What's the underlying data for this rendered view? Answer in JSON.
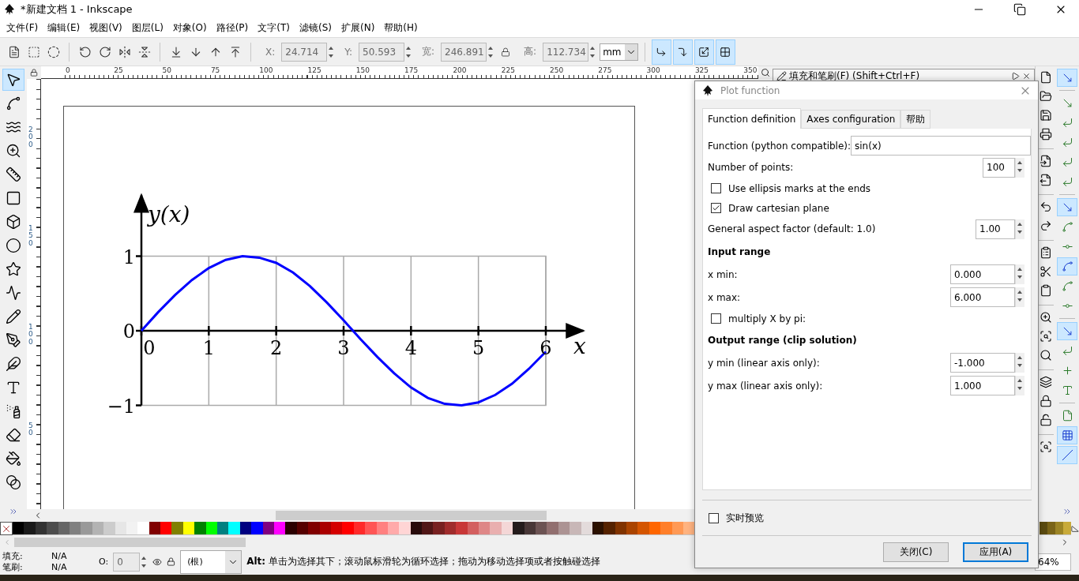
{
  "window": {
    "title": "*新建文档 1 - Inkscape"
  },
  "menu": [
    "文件(F)",
    "编辑(E)",
    "视图(V)",
    "图层(L)",
    "对象(O)",
    "路径(P)",
    "文字(T)",
    "滤镜(S)",
    "扩展(N)",
    "帮助(H)"
  ],
  "toolbar": {
    "fields": [
      {
        "label": "X:",
        "value": "24.714",
        "disabled": true
      },
      {
        "label": "Y:",
        "value": "50.593",
        "disabled": true
      },
      {
        "label": "宽:",
        "value": "246.891",
        "disabled": true
      },
      {
        "label": "高:",
        "value": "112.734",
        "disabled": true
      }
    ],
    "unit": "mm",
    "toggles": [
      {
        "on": true
      },
      {
        "on": true
      },
      {
        "on": true
      },
      {
        "on": true
      }
    ]
  },
  "tools": [
    {
      "selected": true
    },
    {
      "selected": false
    },
    {
      "selected": false
    },
    {
      "selected": false
    },
    {
      "selected": false
    },
    {
      "selected": false
    },
    {
      "selected": false
    },
    {
      "selected": false
    },
    {
      "selected": false
    },
    {
      "selected": false
    },
    {
      "selected": false
    },
    {
      "selected": false
    },
    {
      "selected": false
    },
    {
      "selected": false
    },
    {
      "selected": false
    },
    {
      "selected": false
    },
    {
      "selected": false
    },
    {
      "selected": false
    }
  ],
  "ruler": {
    "horizontal": [
      "0",
      "25",
      "50",
      "75",
      "100",
      "125",
      "150",
      "175",
      "200",
      "225",
      "250",
      "275",
      "300",
      "325",
      "350"
    ],
    "vertical": [
      "200",
      "150",
      "100",
      "50"
    ]
  },
  "plot": {
    "chart_data": {
      "type": "line",
      "xlabel": "x",
      "ylabel": "y(x)",
      "x": [
        0,
        0.25,
        0.5,
        0.75,
        1,
        1.25,
        1.5,
        1.75,
        2,
        2.25,
        2.5,
        2.75,
        3,
        3.25,
        3.5,
        3.75,
        4,
        4.25,
        4.5,
        4.75,
        5,
        5.25,
        5.5,
        5.75,
        6
      ],
      "series": [
        {
          "color": "#0000ff",
          "values": [
            0,
            0.25,
            0.48,
            0.68,
            0.84,
            0.95,
            1,
            0.98,
            0.91,
            0.78,
            0.6,
            0.38,
            0.14,
            -0.11,
            -0.35,
            -0.57,
            -0.76,
            -0.9,
            -0.98,
            -1,
            -0.96,
            -0.86,
            -0.71,
            -0.51,
            -0.28
          ]
        }
      ],
      "xlim": [
        0,
        6.56
      ],
      "ylim": [
        -1,
        1.82
      ],
      "grid": true,
      "xticks": [
        0,
        1,
        2,
        3,
        4,
        5,
        6
      ],
      "yticks": [
        {
          "value": -1,
          "label": "−1"
        },
        0,
        1
      ]
    }
  },
  "dock": {
    "title": "填充和笔刷(F) (Shift+Ctrl+F)"
  },
  "snaps": [
    {
      "on": true
    },
    {
      "on": false
    },
    {
      "on": false
    },
    {
      "on": false
    },
    {
      "on": false
    },
    {
      "on": false
    },
    {
      "on": true
    },
    {
      "on": false
    },
    {
      "on": false
    },
    {
      "on": true
    },
    {
      "on": false
    },
    {
      "on": false
    },
    {
      "on": true
    },
    {
      "on": false
    },
    {
      "on": false
    },
    {
      "on": false
    },
    {
      "on": false
    },
    {
      "on": true
    },
    {
      "on": true
    }
  ],
  "dialog": {
    "title": "Plot function",
    "tabs": [
      {
        "label": "Function definition",
        "selected": true
      },
      {
        "label": "Axes configuration",
        "selected": false
      },
      {
        "label": "帮助",
        "selected": false
      }
    ],
    "rows": [
      {
        "kind": "text",
        "label": "Function (python compatible):",
        "value": "sin(x)"
      },
      {
        "kind": "spin",
        "label": "Number of points:",
        "value": "100"
      },
      {
        "kind": "check",
        "label": "Use ellipsis marks at the ends",
        "checked": false
      },
      {
        "kind": "check",
        "label": "Draw cartesian plane",
        "checked": true
      },
      {
        "kind": "spin",
        "label": "General aspect factor (default: 1.0)",
        "value": "1.00"
      },
      {
        "kind": "heading",
        "label": "Input range"
      },
      {
        "kind": "range",
        "label": "x min:",
        "value": "0.000"
      },
      {
        "kind": "range",
        "label": "x max:",
        "value": "6.000"
      },
      {
        "kind": "check",
        "label": "multiply X by pi:",
        "checked": false
      },
      {
        "kind": "heading",
        "label": "Output range (clip solution)"
      },
      {
        "kind": "range",
        "label": "y min (linear axis only):",
        "value": "-1.000"
      },
      {
        "kind": "range",
        "label": "y max (linear axis only):",
        "value": "1.000"
      }
    ],
    "live_preview": {
      "label": "实时预览",
      "checked": false
    },
    "buttons": [
      {
        "label": "关闭(C)",
        "default": false
      },
      {
        "label": "应用(A)",
        "default": true
      }
    ]
  },
  "palette": [
    {
      "color": "#000000"
    },
    {
      "color": "#1a1a1a"
    },
    {
      "color": "#333333"
    },
    {
      "color": "#4d4d4d"
    },
    {
      "color": "#666666"
    },
    {
      "color": "#808080"
    },
    {
      "color": "#999999"
    },
    {
      "color": "#b3b3b3"
    },
    {
      "color": "#cccccc"
    },
    {
      "color": "#e6e6e6"
    },
    {
      "color": "#f2f2f2"
    },
    {
      "color": "#ffffff"
    },
    {
      "color": "#800000"
    },
    {
      "color": "#ff0000"
    },
    {
      "color": "#808000"
    },
    {
      "color": "#ffff00"
    },
    {
      "color": "#008000"
    },
    {
      "color": "#00ff00"
    },
    {
      "color": "#008080"
    },
    {
      "color": "#00ffff"
    },
    {
      "color": "#000080"
    },
    {
      "color": "#0000ff"
    },
    {
      "color": "#800080"
    },
    {
      "color": "#ff00ff"
    },
    {
      "color": "#2b0000"
    },
    {
      "color": "#550000"
    },
    {
      "color": "#800000"
    },
    {
      "color": "#aa0000"
    },
    {
      "color": "#d40000"
    },
    {
      "color": "#ff0000"
    },
    {
      "color": "#ff2a2a"
    },
    {
      "color": "#ff5555"
    },
    {
      "color": "#ff8080"
    },
    {
      "color": "#ffaaaa"
    },
    {
      "color": "#ffd5d5"
    },
    {
      "color": "#280b0b"
    },
    {
      "color": "#501616"
    },
    {
      "color": "#782121"
    },
    {
      "color": "#a02c2c"
    },
    {
      "color": "#c83737"
    },
    {
      "color": "#d35f5f"
    },
    {
      "color": "#de8787"
    },
    {
      "color": "#e9afaf"
    },
    {
      "color": "#f4d7d7"
    },
    {
      "color": "#241c1c"
    },
    {
      "color": "#483737"
    },
    {
      "color": "#6c5353"
    },
    {
      "color": "#916f6f"
    },
    {
      "color": "#ac9393"
    },
    {
      "color": "#c8b7b7"
    },
    {
      "color": "#e3dbdb"
    },
    {
      "color": "#2b1100"
    },
    {
      "color": "#552200"
    },
    {
      "color": "#803300"
    },
    {
      "color": "#aa4400"
    },
    {
      "color": "#d45500"
    },
    {
      "color": "#ff6600"
    },
    {
      "color": "#ff7f2a"
    },
    {
      "color": "#ff9955"
    },
    {
      "color": "#ffb380"
    }
  ],
  "palette_end": [
    {
      "color": "#5a4a10"
    },
    {
      "color": "#7a6418"
    },
    {
      "color": "#9c8425"
    },
    {
      "color": "#c8aa3a"
    }
  ],
  "status": {
    "fill_label": "填充:",
    "fill_value": "N/A",
    "stroke_label": "笔刷:",
    "stroke_value": "N/A",
    "opacity_label": "O:",
    "opacity_value": "0",
    "opacity_disabled": true,
    "layer": "(根)",
    "message": "**Alt:** 单击为选择其下；滚动鼠标滑轮为循环选择；拖动为移动选择项或者按触碰选择",
    "zoom": "64%"
  }
}
